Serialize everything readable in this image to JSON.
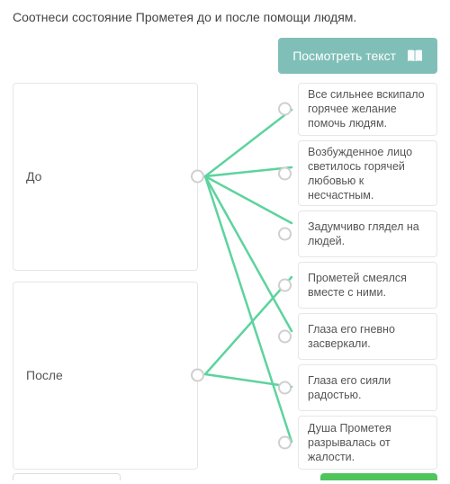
{
  "prompt": "Соотнеси состояние Прометея до и после помощи людям.",
  "view_text_label": "Посмотреть текст",
  "left": {
    "items": [
      {
        "label": "До"
      },
      {
        "label": "После"
      }
    ]
  },
  "right": {
    "items": [
      {
        "label": "Все сильнее вскипало горячее желание помочь людям."
      },
      {
        "label": "Возбужденное лицо светилось горячей любовью к несчастным."
      },
      {
        "label": "Задумчиво глядел на людей."
      },
      {
        "label": "Прометей смеялся вместе с ними."
      },
      {
        "label": "Глаза его гневно засверкали."
      },
      {
        "label": "Глаза его сияли радостью."
      },
      {
        "label": "Душа Прометея разрывалась от жалости."
      }
    ]
  },
  "colors": {
    "button": "#7fbfb8",
    "line": "#5dd39e",
    "submit": "#4fc55b"
  },
  "lines": [
    {
      "from": "L0",
      "to": "R0"
    },
    {
      "from": "L0",
      "to": "R1"
    },
    {
      "from": "L0",
      "to": "R2"
    },
    {
      "from": "L0",
      "to": "R4"
    },
    {
      "from": "L0",
      "to": "R6"
    },
    {
      "from": "L1",
      "to": "R3"
    },
    {
      "from": "L1",
      "to": "R5"
    }
  ]
}
